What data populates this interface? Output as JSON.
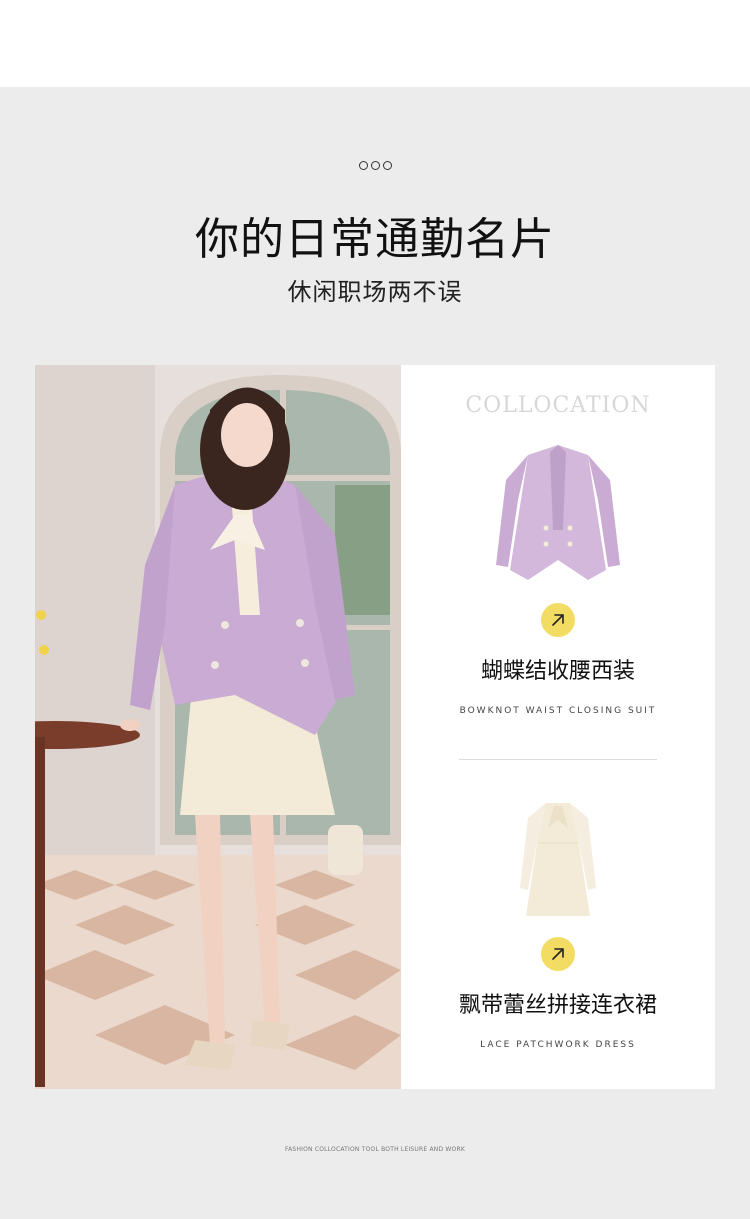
{
  "header": {
    "title": "你的日常通勤名片",
    "subtitle": "休闲职场两不误"
  },
  "panel": {
    "heading": "COLLOCATION",
    "products": [
      {
        "name_cn": "蝴蝶结收腰西装",
        "name_en": "BOWKNOT WAIST CLOSING SUIT",
        "icon": "arrow-up-right-icon"
      },
      {
        "name_cn": "飘带蕾丝拼接连衣裙",
        "name_en": "LACE PATCHWORK DRESS",
        "icon": "arrow-up-right-icon"
      }
    ]
  },
  "footer": {
    "tagline": "FASHION COLLOCATION TOOL BOTH LEISURE AND WORK"
  },
  "colors": {
    "background": "#ececec",
    "accent": "#f3dc63",
    "blazer": "#c9abd3",
    "dress": "#f3ead7"
  }
}
